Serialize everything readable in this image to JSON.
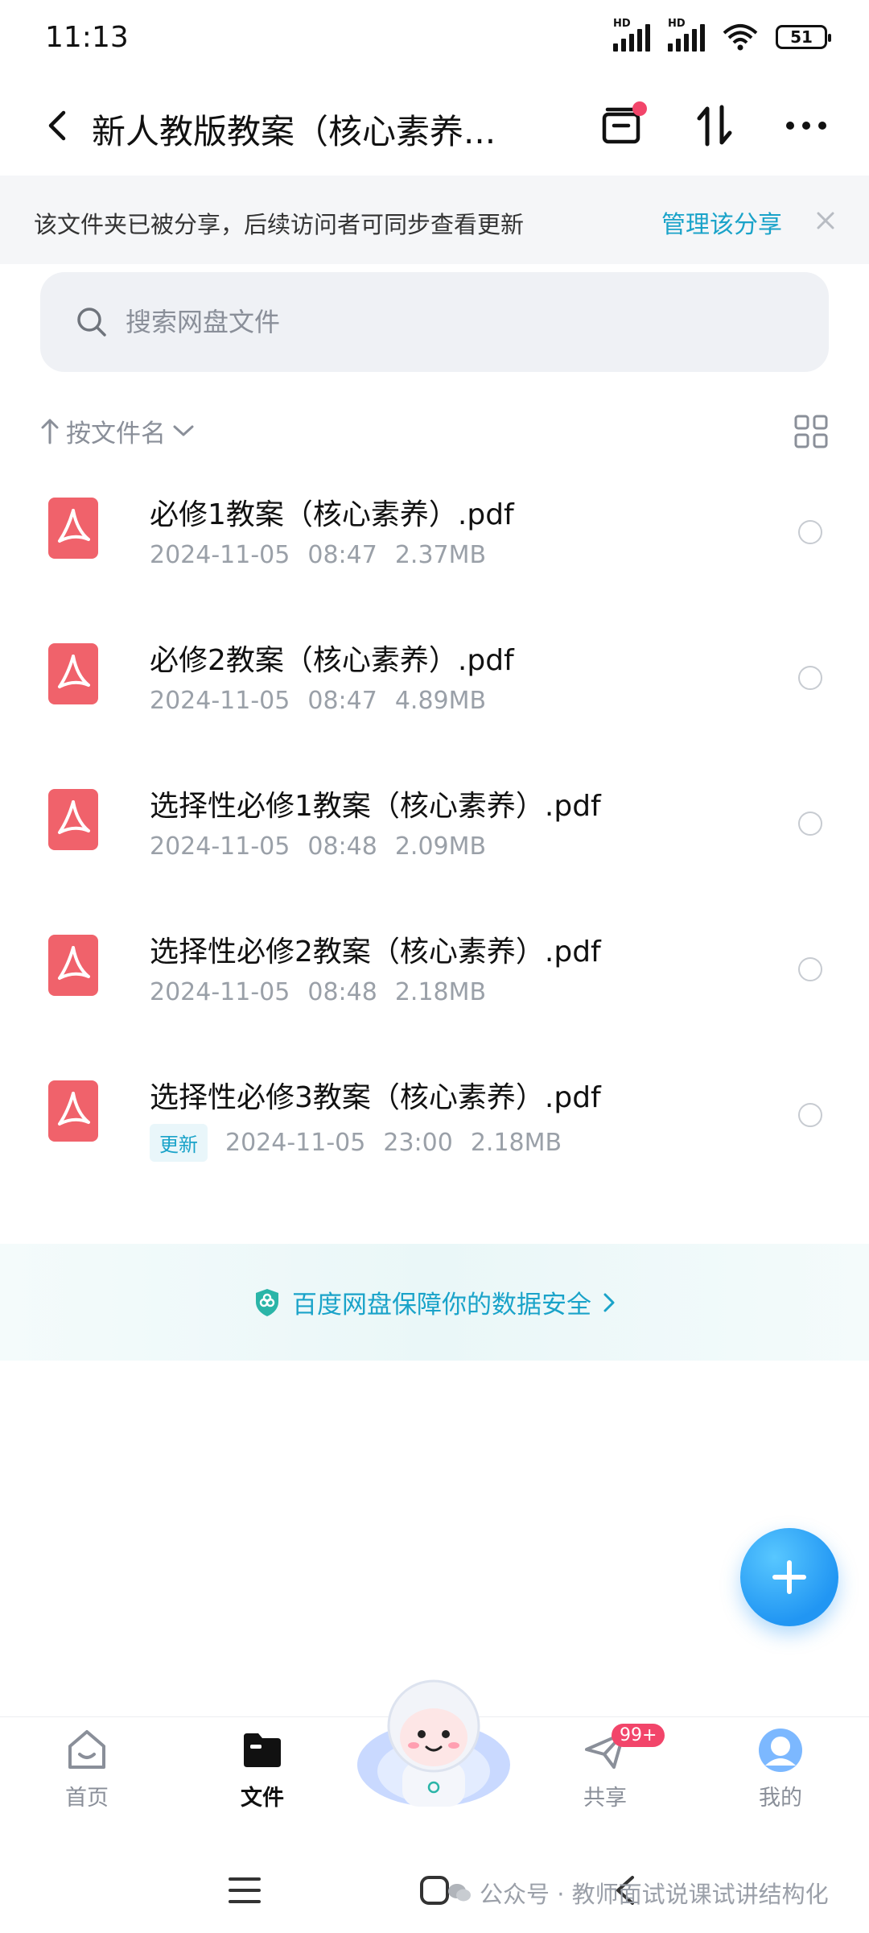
{
  "status_bar": {
    "time": "11:13",
    "signal1_label": "HD",
    "signal2_label": "HD",
    "battery": "51"
  },
  "header": {
    "title": "新人教版教案（核心素养...",
    "icons": [
      "back-icon",
      "archive-icon",
      "sort-transfer-icon",
      "more-icon"
    ]
  },
  "share_banner": {
    "text": "该文件夹已被分享，后续访问者可同步查看更新",
    "link": "管理该分享"
  },
  "search": {
    "placeholder": "搜索网盘文件"
  },
  "sort": {
    "label": "按文件名"
  },
  "files": [
    {
      "name": "必修1教案（核心素养）.pdf",
      "date": "2024-11-05",
      "time": "08:47",
      "size": "2.37MB",
      "badge": ""
    },
    {
      "name": "必修2教案（核心素养）.pdf",
      "date": "2024-11-05",
      "time": "08:47",
      "size": "4.89MB",
      "badge": ""
    },
    {
      "name": "选择性必修1教案（核心素养）.pdf",
      "date": "2024-11-05",
      "time": "08:48",
      "size": "2.09MB",
      "badge": ""
    },
    {
      "name": "选择性必修2教案（核心素养）.pdf",
      "date": "2024-11-05",
      "time": "08:48",
      "size": "2.18MB",
      "badge": ""
    },
    {
      "name": "选择性必修3教案（核心素养）.pdf",
      "date": "2024-11-05",
      "time": "23:00",
      "size": "2.18MB",
      "badge": "更新"
    }
  ],
  "security": {
    "text": "百度网盘保障你的数据安全"
  },
  "bottom_nav": {
    "items": [
      {
        "label": "首页"
      },
      {
        "label": "文件"
      },
      {
        "label": "共享",
        "badge": "99+"
      },
      {
        "label": "我的"
      }
    ]
  },
  "watermark": {
    "text": "公众号 · 教师面试说课试讲结构化"
  },
  "colors": {
    "accent": "#1aa3c9",
    "pdf_red": "#f0626b",
    "badge_red": "#f2456a",
    "fab_blue": "#2196f3"
  }
}
